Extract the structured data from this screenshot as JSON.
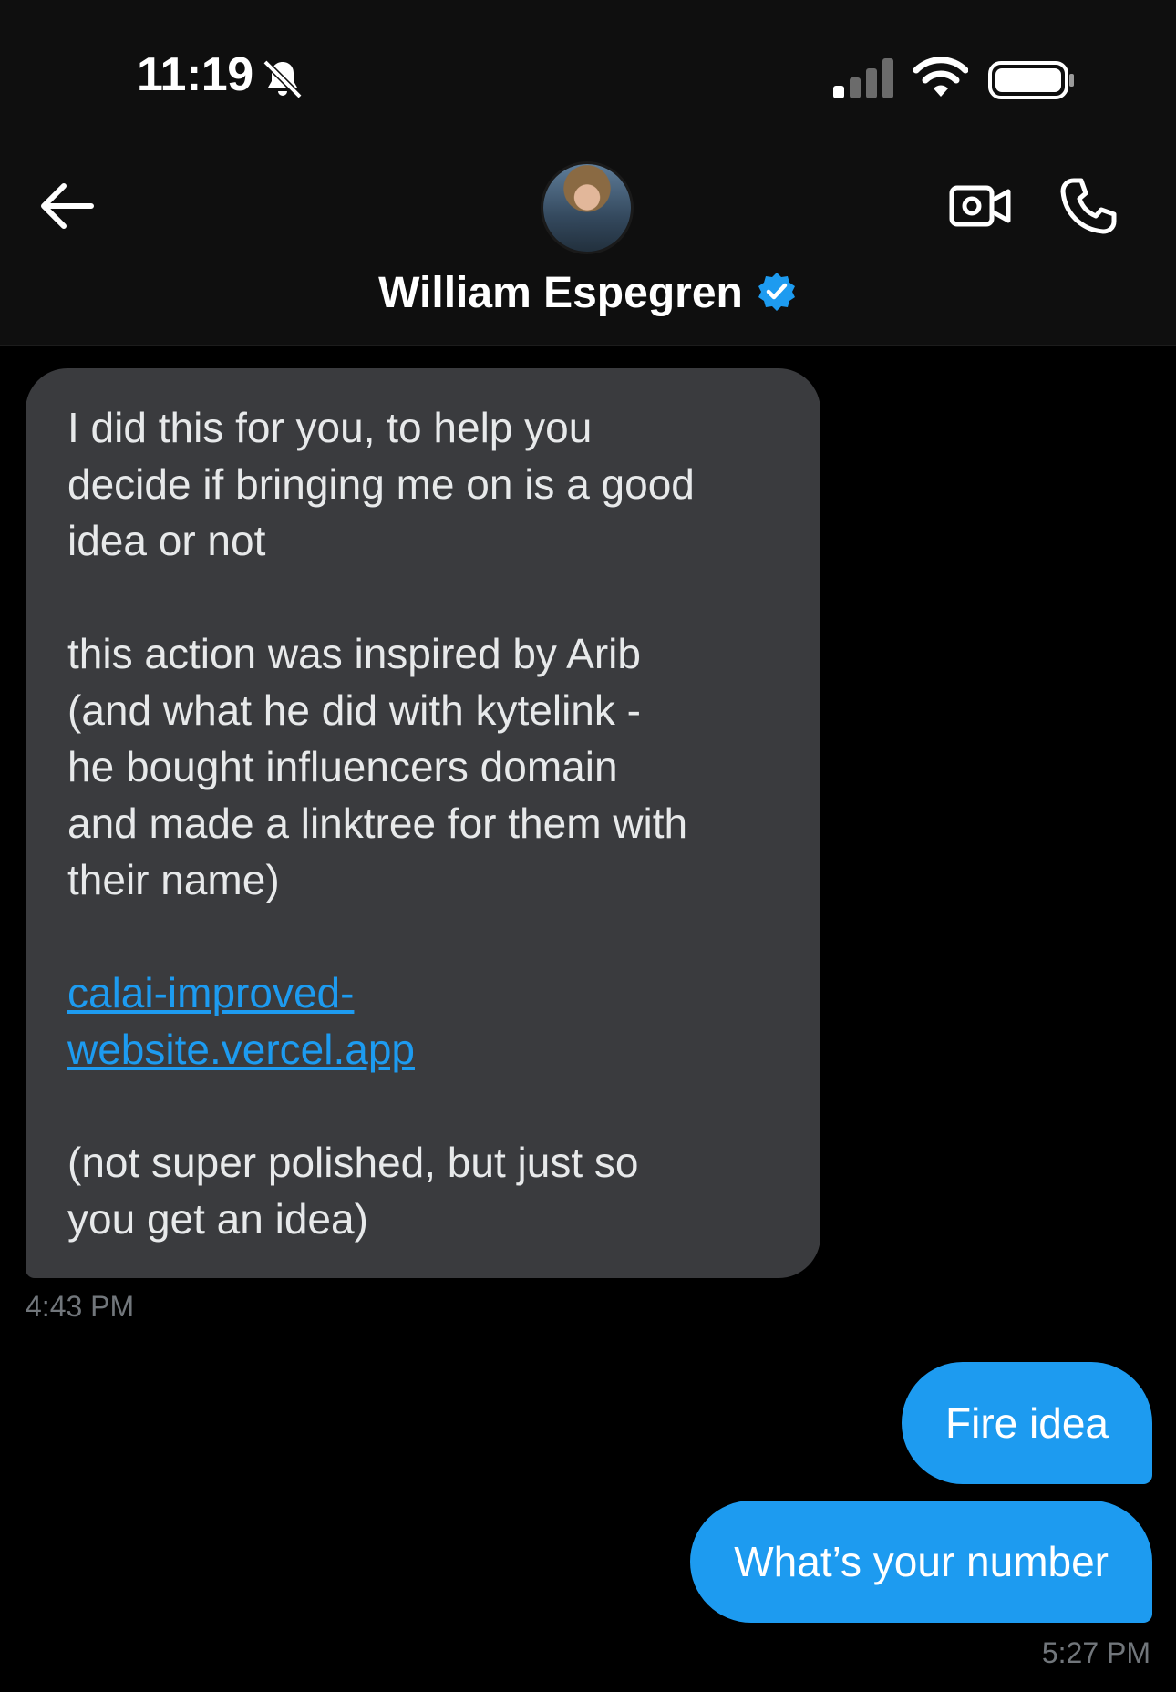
{
  "status_bar": {
    "time": "11:19"
  },
  "header": {
    "contact_name": "William Espegren"
  },
  "messages": {
    "incoming": {
      "paragraphs": [
        "I did this for you, to help you\ndecide if bringing me on is a good\nidea or not",
        "this action was inspired by Arib\n(and what he did with kytelink -\nhe bought influencers domain\nand made a linktree for them with\ntheir name)",
        "calai-improved-\nwebsite.vercel.app",
        "(not super polished, but just so\nyou get an idea)"
      ],
      "time": "4:43 PM"
    },
    "outgoing": [
      {
        "text": "Fire idea"
      },
      {
        "text": "What’s your number"
      }
    ],
    "outgoing_time": "5:27 PM"
  },
  "colors": {
    "accent": "#1d9bf0",
    "incoming_bubble": "#3a3b3e",
    "background": "#000000",
    "timestamp": "#71767b"
  },
  "icons": [
    "bell-off-icon",
    "signal-icon",
    "wifi-icon",
    "battery-icon",
    "back-arrow-icon",
    "video-call-icon",
    "phone-icon",
    "verified-badge-icon"
  ]
}
